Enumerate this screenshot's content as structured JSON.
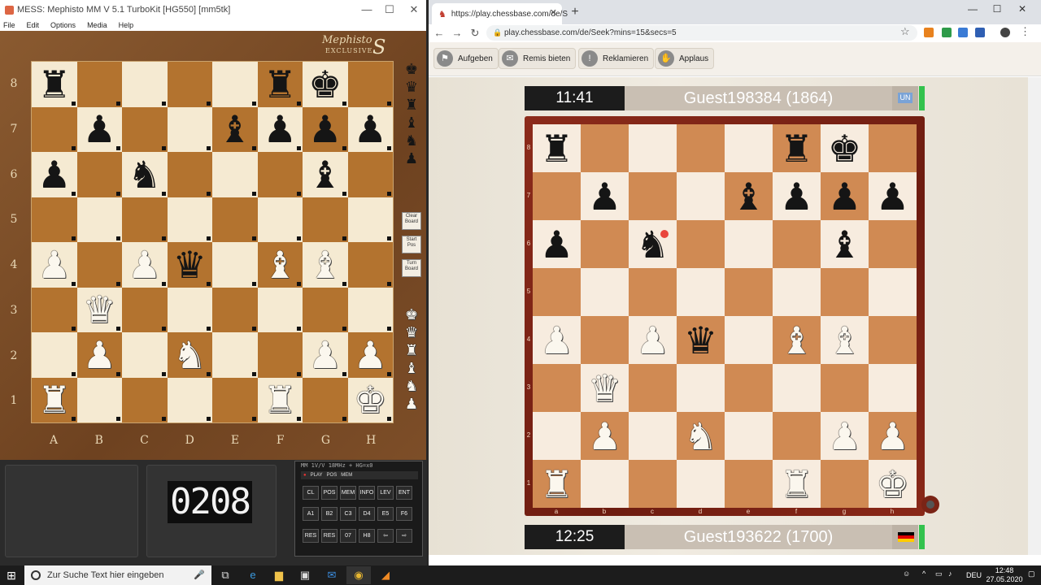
{
  "left_window": {
    "title": "MESS: Mephisto MM V 5.1 TurboKit [HG550] [mm5tk]",
    "menu": [
      "File",
      "Edit",
      "Options",
      "Media",
      "Help"
    ],
    "logo_text": "Mephisto",
    "logo_sub": "EXCLUSIVE",
    "logo_letter": "S",
    "rank_labels": [
      "8",
      "7",
      "6",
      "5",
      "4",
      "3",
      "2",
      "1"
    ],
    "file_labels": [
      "A",
      "B",
      "C",
      "D",
      "E",
      "F",
      "G",
      "H"
    ],
    "side_buttons": [
      {
        "label": "Clear Board"
      },
      {
        "label": "Start Pos"
      },
      {
        "label": "Turn Board"
      }
    ],
    "lcd_display": "0208",
    "panel_info": "MM 1V/V 18MHz + HG=x0",
    "leds": [
      "PLAY",
      "POS",
      "MEM"
    ],
    "keys_row1": [
      "CL",
      "POS",
      "MEM",
      "INFO",
      "LEV",
      "ENT"
    ],
    "keys_row2": [
      "A1",
      "B2",
      "C3",
      "D4",
      "E5",
      "F6"
    ],
    "keys_row3": [
      "RES",
      "RES",
      "07",
      "H8",
      "⇦",
      "⇨"
    ]
  },
  "board_position": [
    [
      "r",
      "",
      "",
      "",
      "",
      "r",
      "k",
      ""
    ],
    [
      "",
      "p",
      "",
      "",
      "b",
      "p",
      "p",
      "p"
    ],
    [
      "p",
      "",
      "n",
      "",
      "",
      "",
      "b",
      ""
    ],
    [
      "",
      "",
      "",
      "",
      "",
      "",
      "",
      ""
    ],
    [
      "P",
      "",
      "P",
      "q",
      "",
      "B",
      "B",
      ""
    ],
    [
      "",
      "Q",
      "",
      "",
      "",
      "",
      "",
      ""
    ],
    [
      "",
      "P",
      "",
      "N",
      "",
      "",
      "P",
      "P"
    ],
    [
      "R",
      "",
      "",
      "",
      "",
      "R",
      "",
      "K"
    ]
  ],
  "browser": {
    "tab_title": "https://play.chessbase.com/de/S",
    "url": "play.chessbase.com/de/Seek?mins=15&secs=5",
    "site_buttons": [
      "Aufgeben",
      "Remis bieten",
      "Reklamieren",
      "Applaus"
    ],
    "top_player": {
      "clock": "11:41",
      "name": "Guest198384 (1864)",
      "flag": "UN"
    },
    "bottom_player": {
      "clock": "12:25",
      "name": "Guest193622 (1700)",
      "flag": "DE"
    },
    "rank_labels": [
      "8",
      "7",
      "6",
      "5",
      "4",
      "3",
      "2",
      "1"
    ],
    "file_labels": [
      "a",
      "b",
      "c",
      "d",
      "e",
      "f",
      "g",
      "h"
    ]
  },
  "taskbar": {
    "search_placeholder": "Zur Suche Text hier eingeben",
    "language": "DEU",
    "time": "12:48",
    "date": "27.05.2020"
  }
}
